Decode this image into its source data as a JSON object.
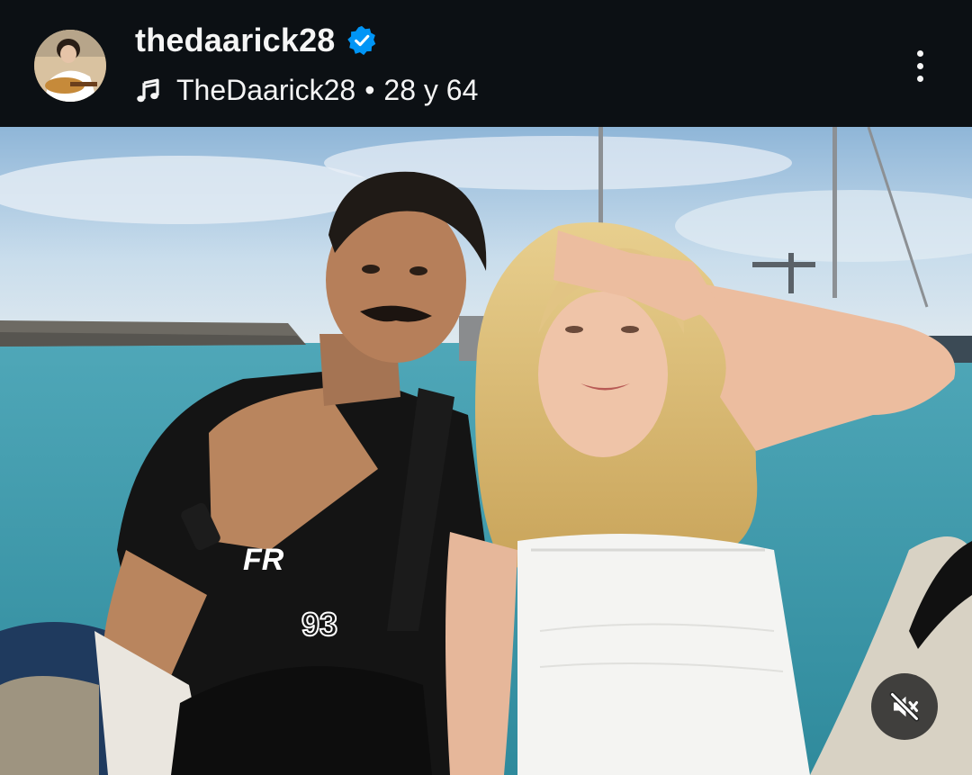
{
  "post_header": {
    "username": "thedaarick28",
    "verified": true,
    "audio_artist": "TheDaarick28",
    "separator": "•",
    "audio_title": "28 y 64"
  },
  "icons": {
    "verified": "verified-badge-icon",
    "music": "music-note-icon",
    "more": "more-vertical-icon",
    "mute": "speaker-muted-icon"
  },
  "colors": {
    "background": "#0c1014",
    "text": "#f5f5f5",
    "verified_badge": "#0095f6",
    "mute_button_bg": "#262626"
  },
  "media": {
    "description_visible": false
  }
}
